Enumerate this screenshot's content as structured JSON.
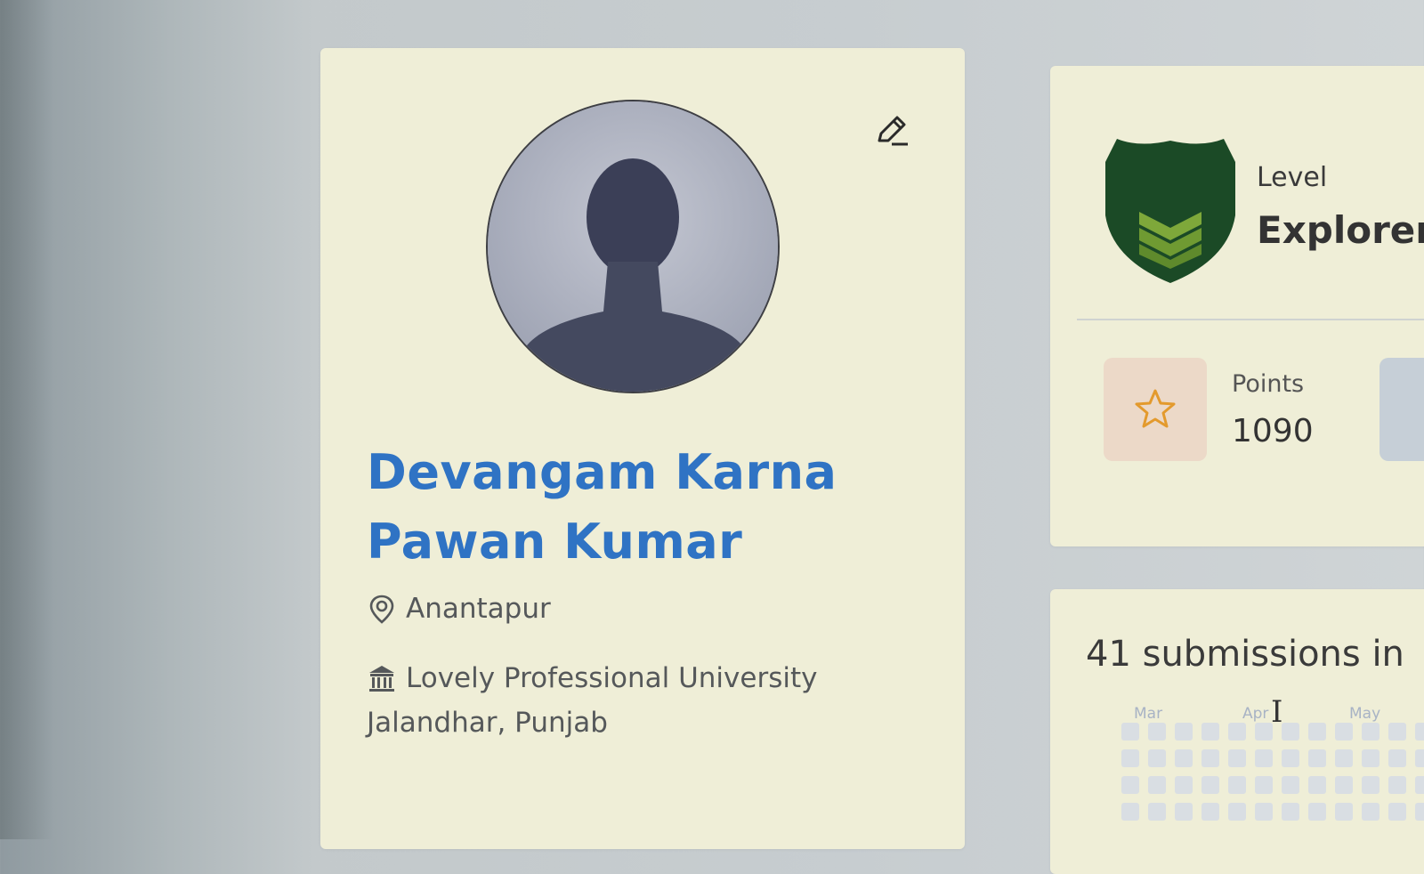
{
  "profile": {
    "name_line1": "Devangam Karna",
    "name_line2": "Pawan Kumar",
    "location": "Anantapur",
    "institution_line1": "Lovely Professional University",
    "institution_line2": "Jalandhar, Punjab",
    "edit_icon": "pencil-icon",
    "avatar_icon": "default-user-silhouette"
  },
  "level": {
    "label": "Level",
    "value": "Explorer",
    "badge_icon": "shield-icon",
    "badge_color": "#1b4a26",
    "badge_accent": "#7ea83a"
  },
  "points": {
    "label": "Points",
    "value": "1090",
    "icon": "star-icon",
    "icon_color": "#e39a2d"
  },
  "submissions": {
    "title": "41 submissions in",
    "months": [
      "Mar",
      "Apr",
      "May"
    ]
  },
  "colors": {
    "accent": "#2f73c4",
    "card_bg": "#efeed7"
  }
}
